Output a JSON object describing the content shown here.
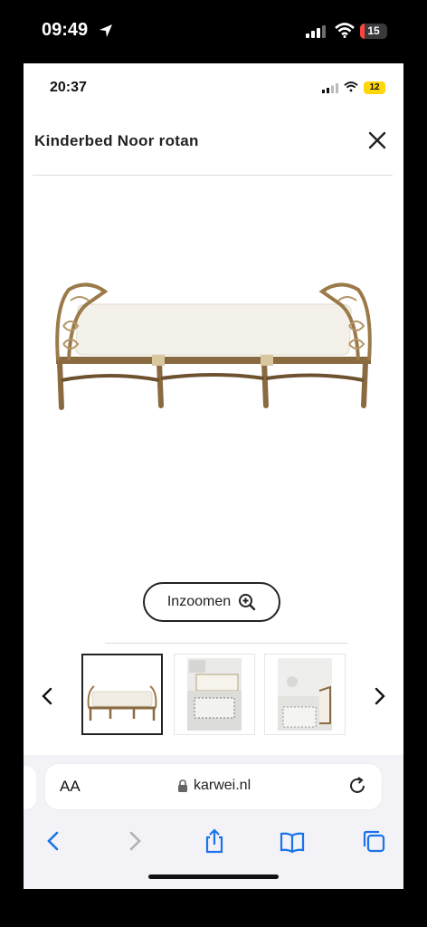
{
  "outer_status": {
    "time": "09:49",
    "battery": "15"
  },
  "inner_status": {
    "time": "20:37",
    "battery": "12"
  },
  "modal": {
    "title": "Kinderbed Noor rotan",
    "zoom_label": "Inzoomen"
  },
  "browser": {
    "aa_label": "AA",
    "domain": "karwei.nl"
  },
  "colors": {
    "battery_low": "#ff453a",
    "battery_saver": "#ffd60a",
    "safari_blue": "#1a73e8"
  },
  "icons": [
    "location-arrow-icon",
    "signal-icon",
    "wifi-icon",
    "battery-icon",
    "close-icon",
    "zoom-in-icon",
    "chevron-left-icon",
    "chevron-right-icon",
    "lock-icon",
    "reload-icon",
    "back-icon",
    "forward-icon",
    "share-icon",
    "bookmarks-icon",
    "tabs-icon"
  ]
}
